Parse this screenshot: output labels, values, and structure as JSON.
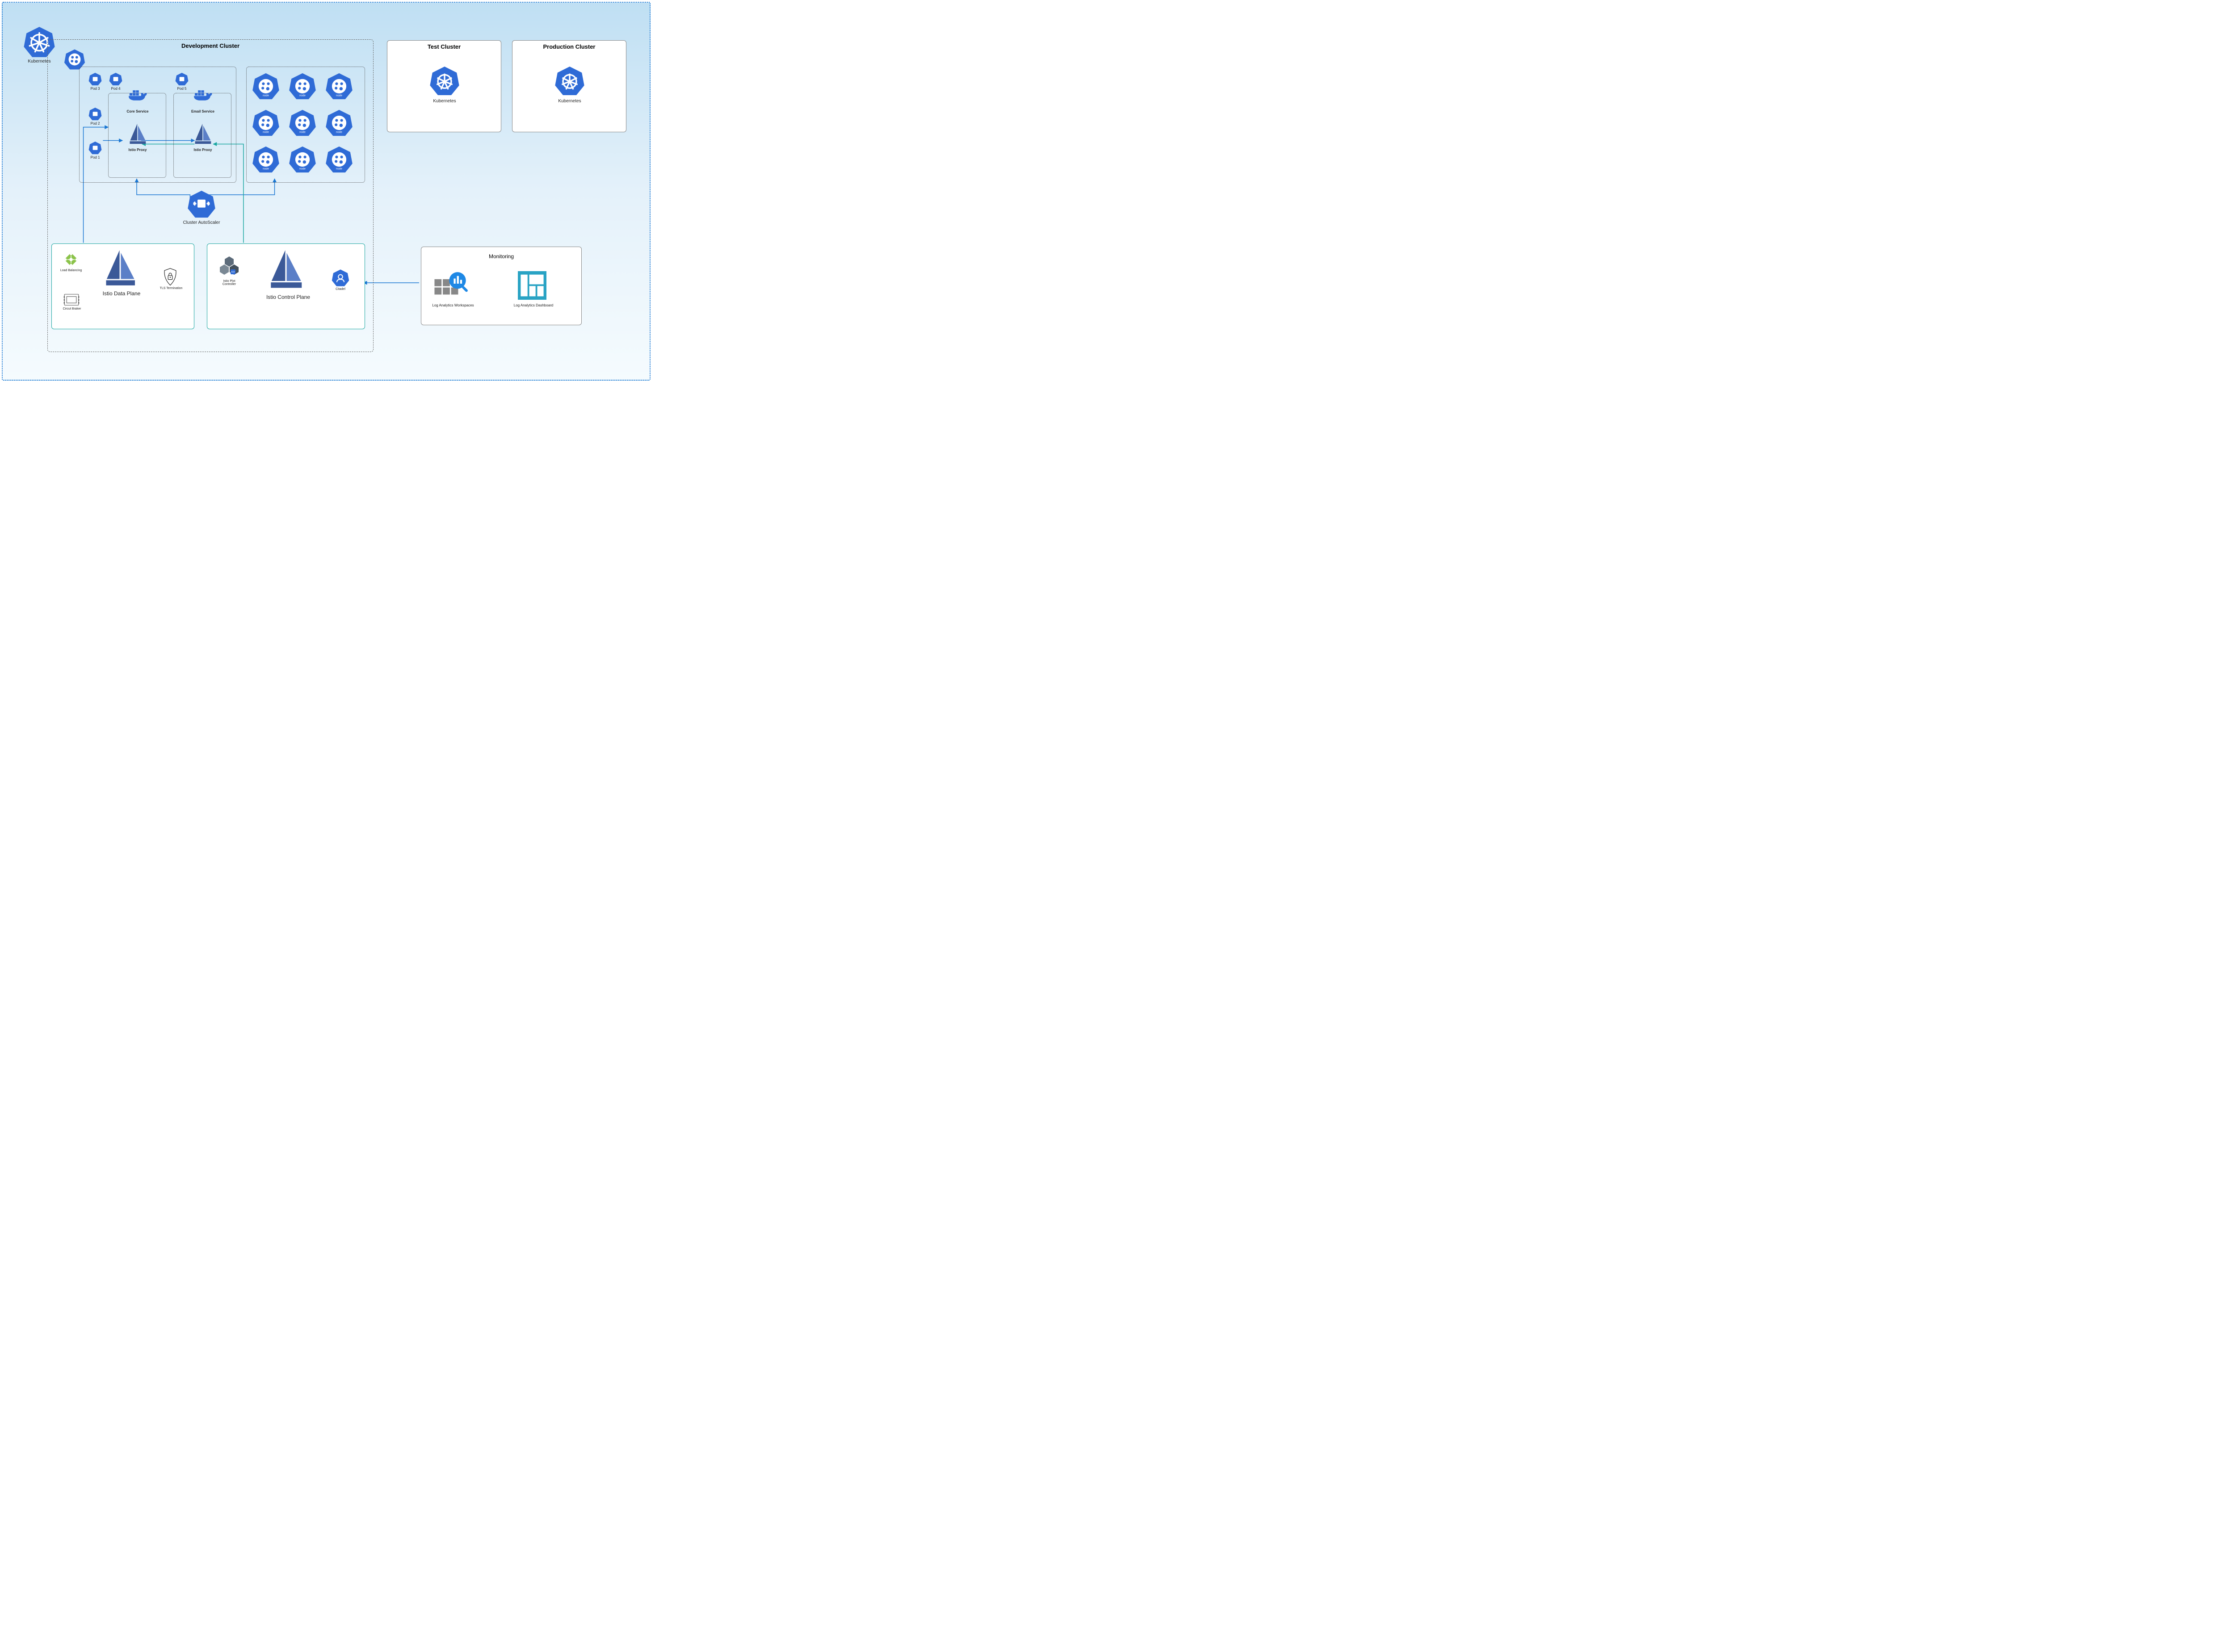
{
  "canvas_label": "Kubernetes",
  "dev_cluster": {
    "title": "Development  Cluster",
    "pods": {
      "p1": "Pod 1",
      "p2": "Pod 2",
      "p3": "Pod 3",
      "p4": "Pod 4",
      "p5": "Pod 5"
    },
    "core_service": "Core Service",
    "email_service": "Email Service",
    "istio_proxy": "Istio Proxy",
    "autoscaler": "Cluster AutoScaler"
  },
  "test_cluster": {
    "title": "Test Cluster",
    "k8s": "Kubernetes"
  },
  "prod_cluster": {
    "title": "Production Cluster",
    "k8s": "Kubernetes"
  },
  "data_plane": {
    "title": "Istio Data Plane",
    "load_balancing": "Load Balancing",
    "tls_termination": "TLS Termination",
    "circuit_breaker": "Circut Braker"
  },
  "control_plane": {
    "title": "Istio Control Plane",
    "pilot": "Istio Plot\nController",
    "citadel": "Citadel"
  },
  "monitoring": {
    "title": "Monitoring",
    "workspaces": "Log Analytics Workspaces",
    "dashboard": "Log Analytics Dashboard"
  },
  "node_label": "node",
  "pod_glyph_label": "pod"
}
